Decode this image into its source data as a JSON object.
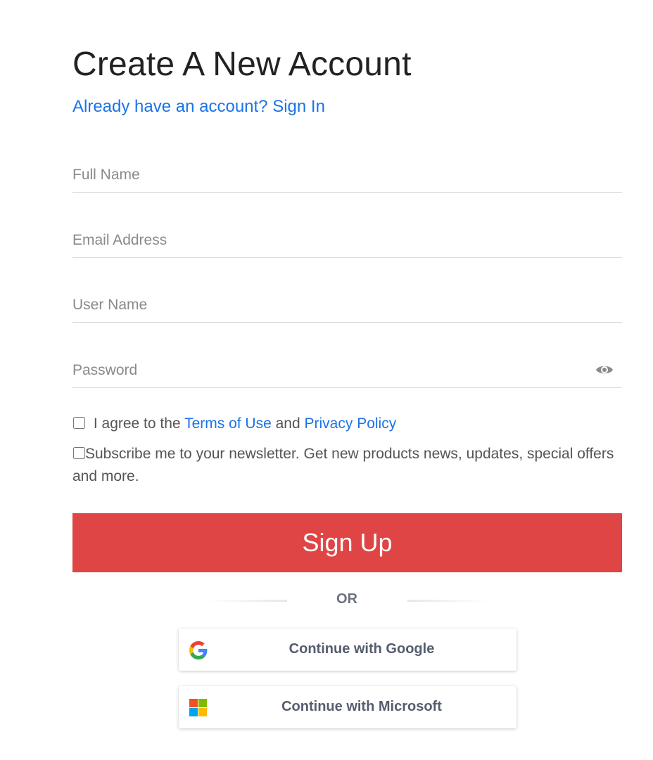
{
  "header": {
    "title": "Create A New Account",
    "signin_link": "Already have an account? Sign In"
  },
  "form": {
    "full_name_placeholder": "Full Name",
    "email_placeholder": "Email Address",
    "username_placeholder": "User Name",
    "password_placeholder": "Password",
    "password_toggle_icon": "eye-icon",
    "agree": {
      "prefix": "I agree to the",
      "terms_link": "Terms of Use",
      "and": "and",
      "privacy_link": "Privacy Policy"
    },
    "newsletter_label": "Subscribe me to your newsletter. Get new products news, updates, special offers and more.",
    "signup_label": "Sign Up",
    "signup_color": "#df4545"
  },
  "divider": {
    "or_label": "OR"
  },
  "social": {
    "google_label": "Continue with Google",
    "google_icon": "google-logo-icon",
    "microsoft_label": "Continue with Microsoft",
    "microsoft_icon": "microsoft-logo-icon"
  },
  "colors": {
    "link": "#1a73e8",
    "title": "#222222",
    "muted_text": "#555555"
  }
}
